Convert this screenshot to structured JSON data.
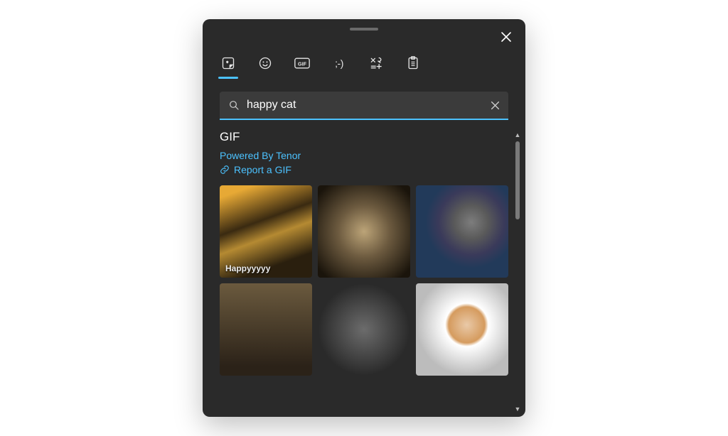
{
  "search": {
    "value": "happy cat",
    "placeholder": "Search"
  },
  "section": {
    "title": "GIF",
    "attribution": "Powered By Tenor",
    "report_label": "Report a GIF"
  },
  "results": [
    {
      "caption": "Happyyyyy"
    },
    {
      "caption": ""
    },
    {
      "caption": ""
    },
    {
      "caption": ""
    },
    {
      "caption": ""
    },
    {
      "caption": ""
    }
  ],
  "tabs": [
    {
      "name": "recent",
      "active": true
    },
    {
      "name": "emoji",
      "active": false
    },
    {
      "name": "gif",
      "active": false
    },
    {
      "name": "kaomoji",
      "active": false
    },
    {
      "name": "symbols",
      "active": false
    },
    {
      "name": "clipboard",
      "active": false
    }
  ]
}
